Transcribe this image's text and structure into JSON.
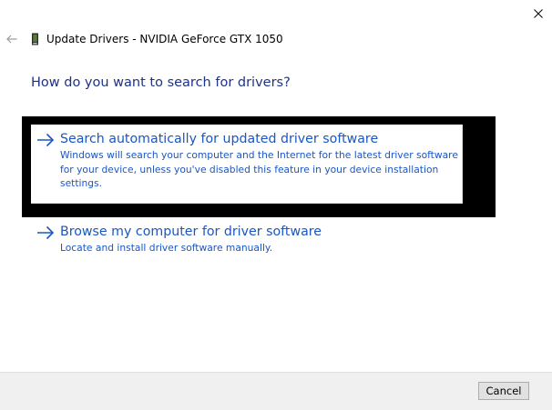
{
  "window": {
    "title": "Update Drivers - NVIDIA GeForce GTX 1050",
    "close_icon": "close-icon",
    "back_icon": "back-arrow-icon",
    "device_icon": "graphics-card-icon"
  },
  "heading": "How do you want to search for drivers?",
  "options": [
    {
      "title": "Search automatically for updated driver software",
      "description": "Windows will search your computer and the Internet for the latest driver software for your device, unless you've disabled this feature in your device installation settings.",
      "icon": "arrow-right-icon",
      "highlighted": true
    },
    {
      "title": "Browse my computer for driver software",
      "description": "Locate and install driver software manually.",
      "icon": "arrow-right-icon",
      "highlighted": false
    }
  ],
  "footer": {
    "cancel_label": "Cancel"
  },
  "colors": {
    "heading": "#1e3287",
    "link": "#1a56c4",
    "highlight_frame": "#000000",
    "footer_bg": "#f0f0f0"
  }
}
